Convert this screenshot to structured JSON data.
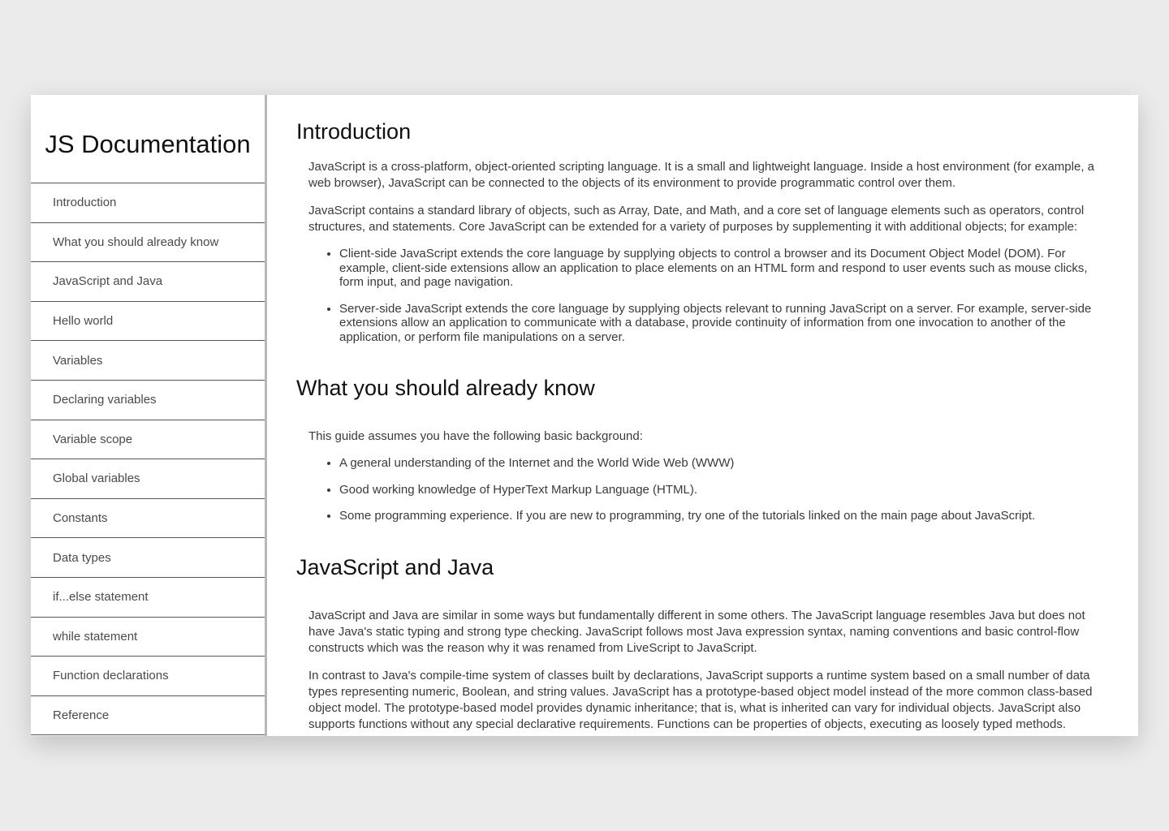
{
  "sidebar": {
    "title": "JS Documentation",
    "items": [
      {
        "label": "Introduction"
      },
      {
        "label": "What you should already know"
      },
      {
        "label": "JavaScript and Java"
      },
      {
        "label": "Hello world"
      },
      {
        "label": "Variables"
      },
      {
        "label": "Declaring variables"
      },
      {
        "label": "Variable scope"
      },
      {
        "label": "Global variables"
      },
      {
        "label": "Constants"
      },
      {
        "label": "Data types"
      },
      {
        "label": "if...else statement"
      },
      {
        "label": "while statement"
      },
      {
        "label": "Function declarations"
      },
      {
        "label": "Reference"
      }
    ]
  },
  "sections": {
    "introduction": {
      "title": "Introduction",
      "paragraphs": [
        "JavaScript is a cross-platform, object-oriented scripting language. It is a small and lightweight language. Inside a host environment (for example, a web browser), JavaScript can be connected to the objects of its environment to provide programmatic control over them.",
        "JavaScript contains a standard library of objects, such as Array, Date, and Math, and a core set of language elements such as operators, control structures, and statements. Core JavaScript can be extended for a variety of purposes by supplementing it with additional objects; for example:"
      ],
      "bullets": [
        "Client-side JavaScript extends the core language by supplying objects to control a browser and its Document Object Model (DOM). For example, client-side extensions allow an application to place elements on an HTML form and respond to user events such as mouse clicks, form input, and page navigation.",
        "Server-side JavaScript extends the core language by supplying objects relevant to running JavaScript on a server. For example, server-side extensions allow an application to communicate with a database, provide continuity of information from one invocation to another of the application, or perform file manipulations on a server."
      ]
    },
    "what_you_should_know": {
      "title": "What you should already know",
      "paragraphs": [
        "This guide assumes you have the following basic background:"
      ],
      "bullets": [
        "A general understanding of the Internet and the World Wide Web (WWW)",
        "Good working knowledge of HyperText Markup Language (HTML).",
        "Some programming experience. If you are new to programming, try one of the tutorials linked on the main page about JavaScript."
      ]
    },
    "javascript_and_java": {
      "title": "JavaScript and Java",
      "paragraphs": [
        "JavaScript and Java are similar in some ways but fundamentally different in some others. The JavaScript language resembles Java but does not have Java's static typing and strong type checking. JavaScript follows most Java expression syntax, naming conventions and basic control-flow constructs which was the reason why it was renamed from LiveScript to JavaScript.",
        "In contrast to Java's compile-time system of classes built by declarations, JavaScript supports a runtime system based on a small number of data types representing numeric, Boolean, and string values. JavaScript has a prototype-based object model instead of the more common class-based object model. The prototype-based model provides dynamic inheritance; that is, what is inherited can vary for individual objects. JavaScript also supports functions without any special declarative requirements. Functions can be properties of objects, executing as loosely typed methods."
      ]
    }
  }
}
